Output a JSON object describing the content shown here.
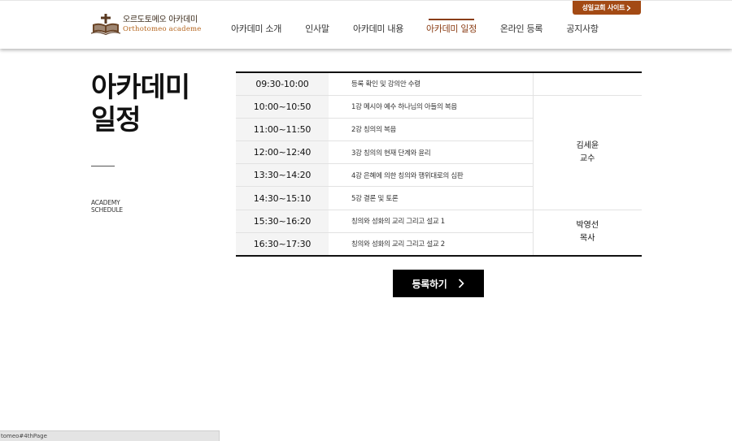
{
  "header": {
    "logo": {
      "name_ko": "오르도토메오 아카데미",
      "name_en": "Orthotomeo academe"
    },
    "site_button": "성일교회 사이트",
    "nav": [
      {
        "label": "아카데미 소개",
        "active": false
      },
      {
        "label": "인사말",
        "active": false
      },
      {
        "label": "아카데미 내용",
        "active": false
      },
      {
        "label": "아카데미 일정",
        "active": true
      },
      {
        "label": "온라인 등록",
        "active": false
      },
      {
        "label": "공지사항",
        "active": false
      }
    ]
  },
  "page": {
    "title_line1": "아카데미",
    "title_line2": "일정",
    "subtitle_line1": "ACADEMY",
    "subtitle_line2": "SCHEDULE"
  },
  "schedule": {
    "rows": [
      {
        "time": "09:30-10:00",
        "topic": "등록 확인 및 강의안 수령"
      },
      {
        "time": "10:00~10:50",
        "topic": "1강 메시야 예수 하나님의 아들의 복음"
      },
      {
        "time": "11:00~11:50",
        "topic": "2강 칭의의 복음"
      },
      {
        "time": "12:00~12:40",
        "topic": "3강 칭의의 현재 단계와 윤리"
      },
      {
        "time": "13:30~14:20",
        "topic": "4강 은혜에 의한 칭의와 행위대로의 심판"
      },
      {
        "time": "14:30~15:10",
        "topic": "5강 결론 및 토론"
      },
      {
        "time": "15:30~16:20",
        "topic": "칭의와 성화의 교리 그리고 설교 1"
      },
      {
        "time": "16:30~17:30",
        "topic": "칭의와 성화의 교리 그리고 설교 2"
      }
    ],
    "lecturers": [
      {
        "name": "김세윤",
        "title": "교수"
      },
      {
        "name": "박영선",
        "title": "목사"
      }
    ]
  },
  "register_button": "등록하기",
  "status_bar": "tomeo#4thPage",
  "colors": {
    "accent": "#8a3d14",
    "site_button": "#a34a14",
    "button_bg": "#000000"
  }
}
